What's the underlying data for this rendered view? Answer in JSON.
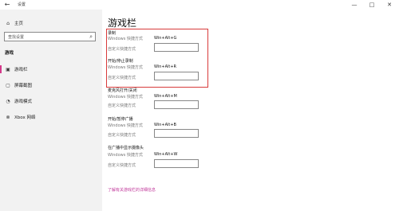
{
  "titlebar": {
    "back_glyph": "←",
    "title": "设置",
    "min_glyph": "—",
    "max_glyph": "□",
    "close_glyph": "✕"
  },
  "sidebar": {
    "home": {
      "label": "主页",
      "icon": "home-icon"
    },
    "search": {
      "placeholder": "查找设置",
      "icon": "search-icon"
    },
    "section": "游戏",
    "items": [
      {
        "label": "游戏栏",
        "icon": "game-bar-icon"
      },
      {
        "label": "屏幕截图",
        "icon": "screenshot-icon"
      },
      {
        "label": "游戏模式",
        "icon": "game-mode-icon"
      },
      {
        "label": "Xbox 网络",
        "icon": "xbox-icon"
      }
    ]
  },
  "main": {
    "title": "游戏栏",
    "groups": [
      {
        "title": "录制",
        "shortcut_label": "Windows 快捷方式",
        "shortcut": "Win+Alt+G",
        "custom_label": "自定义快捷方式",
        "custom_value": ""
      },
      {
        "title": "开始/停止录制",
        "shortcut_label": "Windows 快捷方式",
        "shortcut": "Win+Alt+R",
        "custom_label": "自定义快捷方式",
        "custom_value": ""
      },
      {
        "title": "麦克风打开/关闭",
        "shortcut_label": "Windows 快捷方式",
        "shortcut": "Win+Alt+M",
        "custom_label": "自定义快捷方式",
        "custom_value": ""
      },
      {
        "title": "开始/暂停广播",
        "shortcut_label": "Windows 快捷方式",
        "shortcut": "Win+Alt+B",
        "custom_label": "自定义快捷方式",
        "custom_value": ""
      },
      {
        "title": "在广播中显示摄像头",
        "shortcut_label": "Windows 快捷方式",
        "shortcut": "Win+Alt+W",
        "custom_label": "自定义快捷方式",
        "custom_value": ""
      }
    ],
    "link": "了解有关游戏栏的详细信息"
  },
  "colors": {
    "accent": "#c0379a",
    "highlight_box": "#d83b3b",
    "sidebar_bg": "#f2f2f2"
  }
}
